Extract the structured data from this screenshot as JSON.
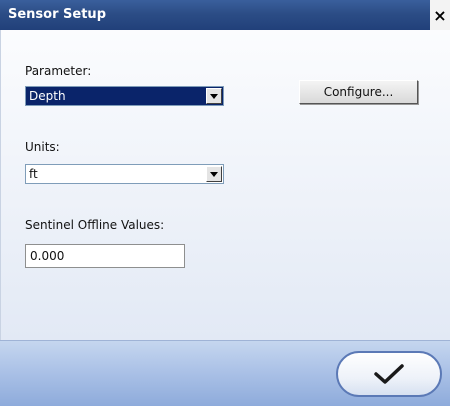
{
  "window": {
    "title": "Sensor Setup",
    "close_label": "×"
  },
  "parameter": {
    "label": "Parameter:",
    "value": "Depth"
  },
  "configure_button": {
    "label": "Configure..."
  },
  "units": {
    "label": "Units:",
    "value": "ft"
  },
  "sentinel": {
    "label": "Sentinel Offline Values:",
    "value": "0.000"
  },
  "footer": {
    "ok_icon": "checkmark-icon"
  },
  "colors": {
    "titlebar": "#2c4d86",
    "focused_select": "#0a246a",
    "footer": "#a9c0e6",
    "ok_border": "#5b79b6"
  }
}
